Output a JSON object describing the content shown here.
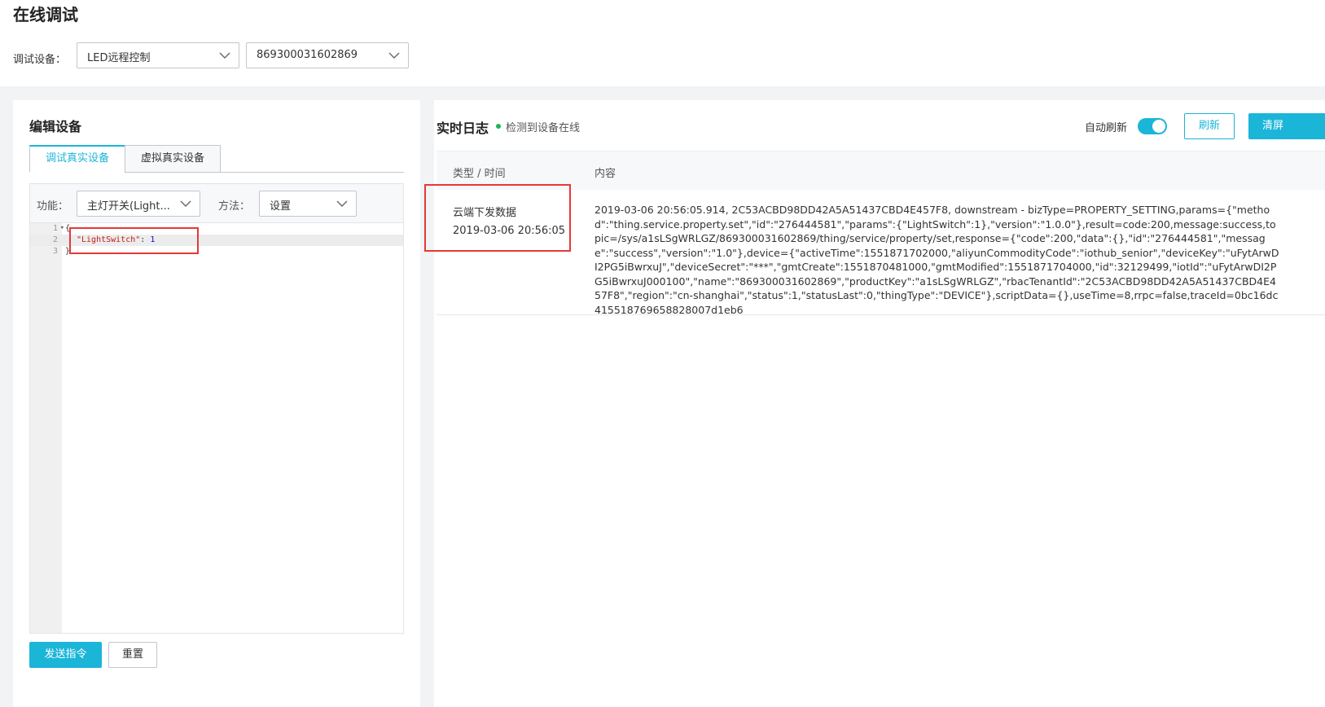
{
  "header": {
    "title": "在线调试",
    "device_label": "调试设备：",
    "product_select": "LED远程控制",
    "device_select": "869300031602869"
  },
  "edit_panel": {
    "title": "编辑设备",
    "tabs": [
      {
        "label": "调试真实设备",
        "active": true
      },
      {
        "label": "虚拟真实设备",
        "active": false
      }
    ],
    "function_label": "功能：",
    "function_value": "主灯开关(Light...",
    "method_label": "方法：",
    "method_value": "设置",
    "code_lines": [
      {
        "num": "1",
        "text": "{"
      },
      {
        "num": "2",
        "key": "\"LightSwitch\"",
        "sep": ": ",
        "value": "1"
      },
      {
        "num": "3",
        "text": "}"
      }
    ],
    "send_button": "发送指令",
    "reset_button": "重置"
  },
  "log_panel": {
    "title": "实时日志",
    "status": "检测到设备在线",
    "auto_refresh_label": "自动刷新",
    "auto_refresh_on": true,
    "refresh_button": "刷新",
    "clear_button": "清屏",
    "columns": [
      "类型 / 时间",
      "内容"
    ],
    "rows": [
      {
        "type": "云端下发数据",
        "time": "2019-03-06 20:56:05",
        "content": "2019-03-06 20:56:05.914, 2C53ACBD98DD42A5A51437CBD4E457F8, downstream - bizType=PROPERTY_SETTING,params={\"method\":\"thing.service.property.set\",\"id\":\"276444581\",\"params\":{\"LightSwitch\":1},\"version\":\"1.0.0\"},result=code:200,message:success,topic=/sys/a1sLSgWRLGZ/869300031602869/thing/service/property/set,response={\"code\":200,\"data\":{},\"id\":\"276444581\",\"message\":\"success\",\"version\":\"1.0\"},device={\"activeTime\":1551871702000,\"aliyunCommodityCode\":\"iothub_senior\",\"deviceKey\":\"uFytArwDI2PG5iBwrxuJ\",\"deviceSecret\":\"***\",\"gmtCreate\":1551870481000,\"gmtModified\":1551871704000,\"id\":32129499,\"iotId\":\"uFytArwDI2PG5iBwrxuJ000100\",\"name\":\"869300031602869\",\"productKey\":\"a1sLSgWRLGZ\",\"rbacTenantId\":\"2C53ACBD98DD42A5A51437CBD4E457F8\",\"region\":\"cn-shanghai\",\"status\":1,\"statusLast\":0,\"thingType\":\"DEVICE\"},scriptData={},useTime=8,rrpc=false,traceId=0bc16dc415518769658828007d1eb6"
      }
    ]
  }
}
